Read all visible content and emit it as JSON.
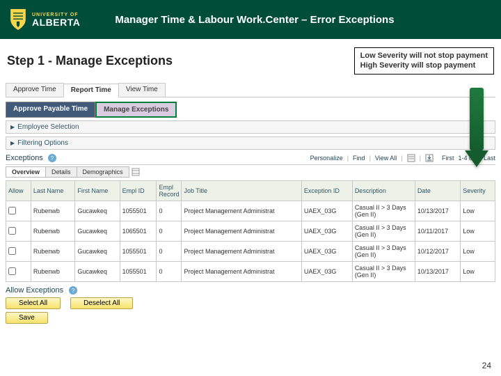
{
  "logo": {
    "top": "UNIVERSITY OF",
    "bottom": "ALBERTA"
  },
  "banner_title": "Manager Time & Labour Work.Center – Error Exceptions",
  "step_title": "Step 1 - Manage Exceptions",
  "note": {
    "line1": "Low Severity will not stop payment",
    "line2": "High Severity will stop payment"
  },
  "top_tabs": [
    {
      "label": "Approve Time",
      "active": false
    },
    {
      "label": "Report Time",
      "active": true
    },
    {
      "label": "View Time",
      "active": false
    }
  ],
  "sub_tabs": {
    "first": "Approve Payable Time",
    "second": "Manage Exceptions"
  },
  "sections": {
    "emp": "Employee Selection",
    "filter": "Filtering Options"
  },
  "exceptions": {
    "title": "Exceptions",
    "toolbar": {
      "personalize": "Personalize",
      "find": "Find",
      "viewall": "View All",
      "pager": "1-4 of 4",
      "first": "First",
      "last": "Last"
    },
    "inner_tabs": [
      "Overview",
      "Details",
      "Demographics"
    ],
    "columns": [
      "Allow",
      "Last Name",
      "First Name",
      "Empl ID",
      "Empl Record",
      "Job Title",
      "Exception ID",
      "Description",
      "Date",
      "Severity"
    ]
  },
  "rows": [
    {
      "ln": "Rubenwb",
      "fn": "Gucawkeq",
      "id": "1055501",
      "rec": "0",
      "title": "Project Management Administrat",
      "exid": "UAEX_03G",
      "desc": "Casual II > 3 Days (Gen II)",
      "date": "10/13/2017",
      "sev": "Low"
    },
    {
      "ln": "Rubenwb",
      "fn": "Gucawkeq",
      "id": "1065501",
      "rec": "0",
      "title": "Project Management Administrat",
      "exid": "UAEX_03G",
      "desc": "Casual II > 3 Days (Gen II)",
      "date": "10/11/2017",
      "sev": "Low"
    },
    {
      "ln": "Rubenwb",
      "fn": "Gucawkeq",
      "id": "1055501",
      "rec": "0",
      "title": "Project Management Administrat",
      "exid": "UAEX_03G",
      "desc": "Casual II > 3 Days (Gen II)",
      "date": "10/12/2017",
      "sev": "Low"
    },
    {
      "ln": "Rubenwb",
      "fn": "Gucawkeq",
      "id": "1055501",
      "rec": "0",
      "title": "Project Management Administrat",
      "exid": "UAEX_03G",
      "desc": "Casual II > 3 Days (Gen II)",
      "date": "10/13/2017",
      "sev": "Low"
    }
  ],
  "allow_section": "Allow Exceptions",
  "buttons": {
    "select_all": "Select All",
    "deselect_all": "Deselect All",
    "save": "Save"
  },
  "page_number": "24"
}
